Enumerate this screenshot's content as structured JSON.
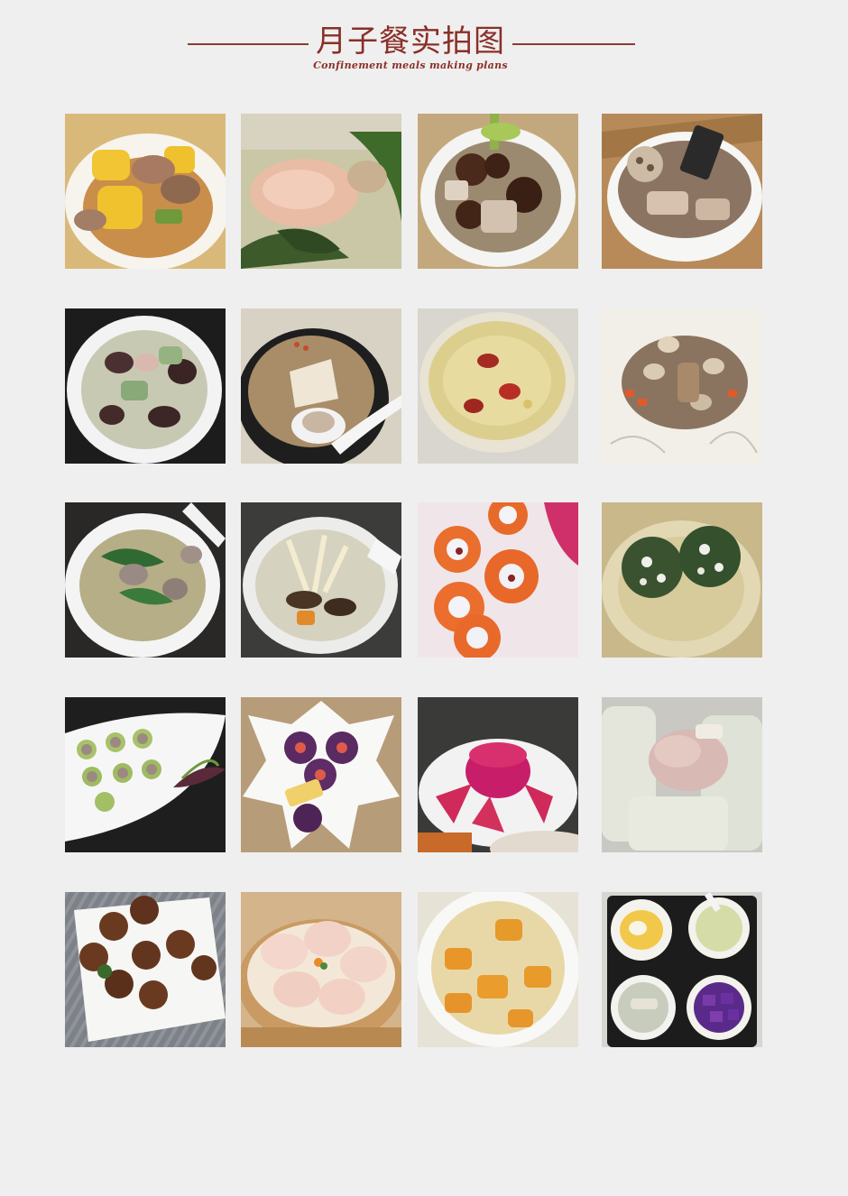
{
  "header": {
    "title": "月子餐实拍图",
    "subtitle": "Confinement meals making plans"
  },
  "gallery": {
    "photos": [
      {
        "icon": "corn-pork-rib-soup"
      },
      {
        "icon": "kelp-pork-rib-soup"
      },
      {
        "icon": "mushroom-pork-rib-soup"
      },
      {
        "icon": "lotus-root-pork-rib-soup"
      },
      {
        "icon": "black-fungus-loofah-soup"
      },
      {
        "icon": "white-radish-soup-with-spoon"
      },
      {
        "icon": "tremella-red-date-soup"
      },
      {
        "icon": "stir-fried-mushrooms-and-kidney"
      },
      {
        "icon": "green-vegetable-meatball-soup"
      },
      {
        "icon": "bamboo-shoot-mushroom-soup"
      },
      {
        "icon": "carrot-slices-with-cream"
      },
      {
        "icon": "spinach-rice-balls"
      },
      {
        "icon": "stuffed-loofah-rolls"
      },
      {
        "icon": "purple-rice-sushi-platter"
      },
      {
        "icon": "dragon-fruit-dessert"
      },
      {
        "icon": "winter-melon-pork-rib"
      },
      {
        "icon": "shiitake-mushroom-buns"
      },
      {
        "icon": "steamed-shrimp-dumplings"
      },
      {
        "icon": "pumpkin-rice"
      },
      {
        "icon": "meal-tray-set"
      }
    ]
  }
}
